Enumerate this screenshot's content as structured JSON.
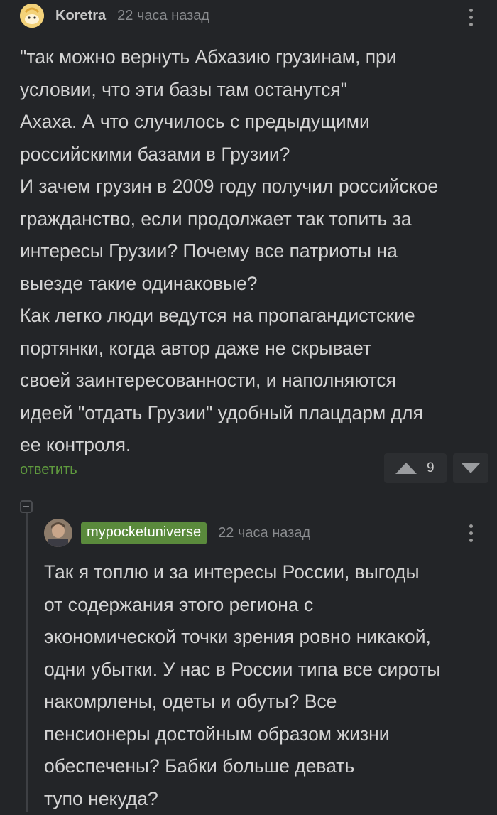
{
  "comment1": {
    "author": "Koretra",
    "time": "22 часа назад",
    "text": "\"так можно вернуть Абхазию грузинам, при\nусловии, что эти базы там останутся\"\nАхаха. А что случилось с предыдущими\nроссийскими базами в Грузии?\nИ зачем грузин в 2009 году получил российское\nгражданство, если продолжает так топить за\nинтересы Грузии? Почему все патриоты на\nвыезде такие одинаковые?\nКак легко люди ведутся на пропагандистские\nпортянки, когда автор даже не скрывает\nсвоей заинтересованности, и наполняются\nидеей \"отдать Грузии\" удобный плацдарм для\nее контроля.",
    "reply_label": "ответить",
    "score": "9"
  },
  "comment2": {
    "author": "mypocketuniverse",
    "time": "22 часа назад",
    "text": "Так я топлю и за интересы России, выгоды\nот содержания этого региона с\nэкономической точки зрения ровно никакой,\nодни убытки. У нас в России типа все сироты\nнакомрлены, одеты и обуты? Все\nпенсионеры достойным образом жизни\nобеспечены? Бабки больше девать\nтупо некуда?"
  },
  "colors": {
    "background": "#232528",
    "accent_green": "#5a8a3c",
    "reply_green": "#5f9a3e"
  }
}
